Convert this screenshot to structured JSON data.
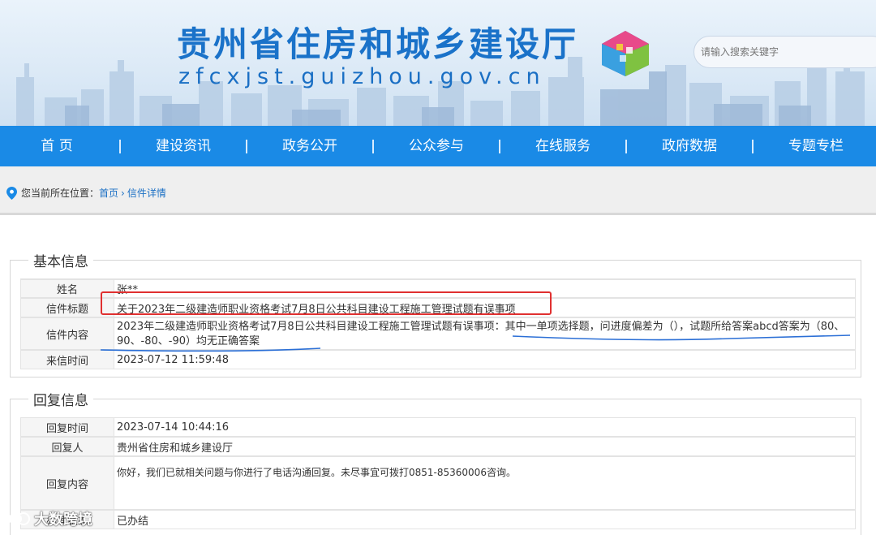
{
  "header": {
    "title": "贵州省住房和城乡建设厅",
    "url": "zfcxjst.guizhou.gov.cn",
    "search_placeholder": "请输入搜索关键字"
  },
  "nav": {
    "items": [
      "首  页",
      "建设资讯",
      "政务公开",
      "公众参与",
      "在线服务",
      "政府数据",
      "专题专栏"
    ],
    "separator": "|"
  },
  "breadcrumb": {
    "prefix": "您当前所在位置：",
    "home": "首页",
    "sep": "›",
    "current": "信件详情"
  },
  "basic": {
    "legend": "基本信息",
    "name_label": "姓名",
    "name_value": "张**",
    "subject_label": "信件标题",
    "subject_value": "关于2023年二级建造师职业资格考试7月8日公共科目建设工程施工管理试题有误事项",
    "content_label": "信件内容",
    "content_value": "2023年二级建造师职业资格考试7月8日公共科目建设工程施工管理试题有误事项：其中一单项选择题，问进度偏差为（），试题所给答案abcd答案为（80、90、-80、-90）均无正确答案",
    "time_label": "来信时间",
    "time_value": "2023-07-12 11:59:48"
  },
  "reply": {
    "legend": "回复信息",
    "time_label": "回复时间",
    "time_value": "2023-07-14 10:44:16",
    "replier_label": "回复人",
    "replier_value": "贵州省住房和城乡建设厅",
    "content_label": "回复内容",
    "content_value": "你好，我们已就相关问题与你进行了电话沟通回复。未尽事宜可拨打0851-85360006咨询。",
    "status_label": "办理状态",
    "status_value": "已办结"
  },
  "watermark": "大数跨境",
  "colors": {
    "nav_bg": "#1a8ae6",
    "title": "#1a72c9",
    "highlight_box": "#e03030",
    "underline": "#2b6fd6"
  }
}
